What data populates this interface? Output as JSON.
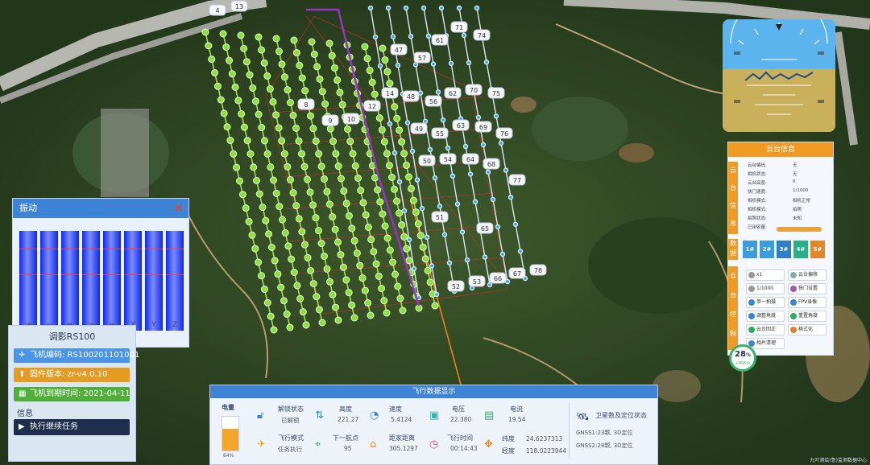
{
  "vibration_panel": {
    "title": "振动",
    "close_glyph": "✕",
    "axis_labels": [
      "速",
      "左",
      "角",
      "姿",
      "角",
      "Y",
      "Y",
      "Z"
    ]
  },
  "drone_panel": {
    "title": "调影RS100",
    "items": [
      {
        "icon": "plane-icon",
        "text": "飞机编码: RS100201101001",
        "color": "#4a95e6"
      },
      {
        "icon": "upload-icon",
        "text": "固件版本: zr-v4.0.10",
        "color": "#e49b22"
      },
      {
        "icon": "calendar-icon",
        "text": "飞机到期时间: 2021-04-11",
        "color": "#52ae3b"
      }
    ],
    "info_label": "信息",
    "task_button": "执行继续任务"
  },
  "gimbal_panel": {
    "title": "云台信息",
    "side_info": "云台信息",
    "side_data": "数据",
    "side_control": "云台控制",
    "rows": [
      {
        "k": "云台编码:",
        "v": "无"
      },
      {
        "k": "相机状态:",
        "v": "无"
      },
      {
        "k": "云台高度:",
        "v": "0"
      },
      {
        "k": "快门速度:",
        "v": "1/1000"
      },
      {
        "k": "相机模式:",
        "v": "相机正常"
      },
      {
        "k": "相机模式:",
        "v": "拍照"
      },
      {
        "k": "拍照状态:",
        "v": "未知"
      },
      {
        "k": "已用容量:",
        "v": ""
      }
    ],
    "keys": [
      {
        "label": "1#",
        "color": "#3d9be0"
      },
      {
        "label": "2#",
        "color": "#3d9be0"
      },
      {
        "label": "3#",
        "color": "#2f7fc8"
      },
      {
        "label": "4#",
        "color": "#27b08a"
      },
      {
        "label": "5#",
        "color": "#e0872a"
      }
    ],
    "controls": [
      {
        "label": "x1",
        "dot": "#999"
      },
      {
        "label": "云台偏移",
        "dot": "#8aa"
      },
      {
        "label": "1/1000",
        "dot": "#999"
      },
      {
        "label": "快门设置",
        "dot": "#9b59b6"
      },
      {
        "label": "单一拍摄",
        "dot": "#3d83d6"
      },
      {
        "label": "FPV录像",
        "dot": "#3d83d6"
      },
      {
        "label": "调整角度",
        "dot": "#3d83d6"
      },
      {
        "label": "重置角度",
        "dot": "#27ae60"
      },
      {
        "label": "云台回正",
        "dot": "#27ae60"
      },
      {
        "label": "格式化",
        "dot": "#e67e22"
      },
      {
        "label": "相片清理",
        "dot": "#3d83d6"
      }
    ]
  },
  "battery_ring": {
    "percent": "28",
    "unit": "%",
    "sub": "+99Km"
  },
  "flight_data": {
    "title": "飞行数据显示",
    "battery_label": "电量",
    "battery_level": 0.64,
    "battery_percent": "64%",
    "items": [
      {
        "label": "解锁状态",
        "value": "已解锁"
      },
      {
        "label": "高度",
        "value": "221.27"
      },
      {
        "label": "速度",
        "value": "5.4124"
      },
      {
        "label": "电压",
        "value": "22.380"
      },
      {
        "label": "电流",
        "value": "19.54"
      },
      {
        "label": "飞行模式",
        "value": "任务执行"
      },
      {
        "label": "下一航点",
        "value": "95"
      },
      {
        "label": "距家距离",
        "value": "305.1297"
      },
      {
        "label": "飞行时间",
        "value": "00:14:43"
      },
      {
        "label": "纬度",
        "value": "24.6237313"
      },
      {
        "label": "经度",
        "value": "118.0223944"
      }
    ],
    "satellite_title": "卫星数及定位状态",
    "gnss1": "GNSS1:23颗, 3D定位",
    "gnss2": "GNSS2:28颗, 3D定位"
  },
  "footer_note": "九叶测绘(鲁)监测数据中心",
  "waypoint_labels": [
    "4",
    "13",
    "47",
    "61",
    "71",
    "74",
    "57",
    "48",
    "56",
    "62",
    "70",
    "75",
    "49",
    "55",
    "63",
    "69",
    "76",
    "50",
    "54",
    "64",
    "68",
    "77",
    "51",
    "65",
    "67",
    "78",
    "52",
    "53",
    "66",
    "8",
    "9",
    "10",
    "12",
    "14"
  ]
}
